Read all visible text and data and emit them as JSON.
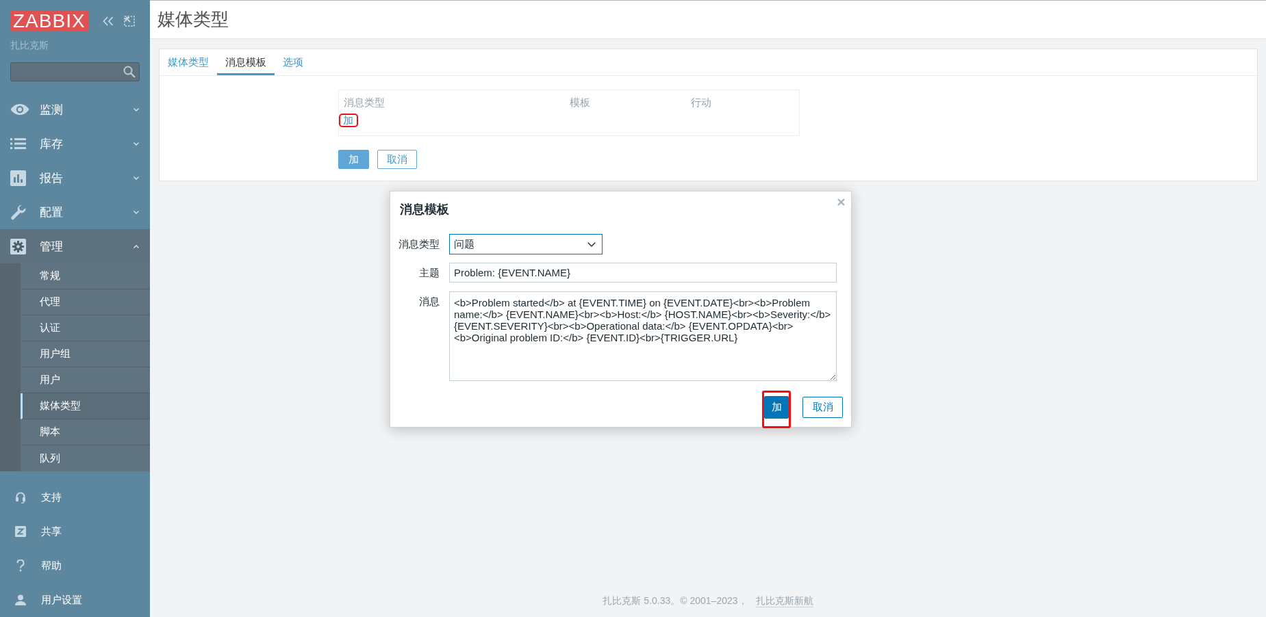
{
  "sidebar": {
    "logo": "ZABBIX",
    "server_name": "扎比克斯",
    "menu": [
      {
        "label": "监测",
        "expanded": false
      },
      {
        "label": "库存",
        "expanded": false
      },
      {
        "label": "报告",
        "expanded": false
      },
      {
        "label": "配置",
        "expanded": false
      },
      {
        "label": "管理",
        "expanded": true,
        "children": [
          {
            "label": "常规",
            "selected": false
          },
          {
            "label": "代理",
            "selected": false
          },
          {
            "label": "认证",
            "selected": false
          },
          {
            "label": "用户组",
            "selected": false
          },
          {
            "label": "用户",
            "selected": false
          },
          {
            "label": "媒体类型",
            "selected": true
          },
          {
            "label": "脚本",
            "selected": false
          },
          {
            "label": "队列",
            "selected": false
          }
        ]
      }
    ],
    "footer_links": [
      {
        "label": "支持"
      },
      {
        "label": "共享"
      },
      {
        "label": "帮助"
      },
      {
        "label": "用户设置"
      }
    ]
  },
  "header": {
    "title": "媒体类型"
  },
  "tabs": [
    {
      "label": "媒体类型",
      "selected": false
    },
    {
      "label": "消息模板",
      "selected": true
    },
    {
      "label": "选项",
      "selected": false
    }
  ],
  "template_table": {
    "columns": [
      "消息类型",
      "模板",
      "行动"
    ],
    "add_link": {
      "label": "加",
      "annotated": true
    }
  },
  "form_buttons": [
    {
      "label": "加",
      "kind": "primary"
    },
    {
      "label": "取消",
      "kind": "secondary"
    }
  ],
  "dialog": {
    "title": "消息模板",
    "fields": [
      {
        "label": "消息类型",
        "kind": "select",
        "value": "问题",
        "focused": true
      },
      {
        "label": "主题",
        "kind": "input",
        "value": "Problem: {EVENT.NAME}",
        "focused": false
      },
      {
        "label": "消息",
        "kind": "textarea",
        "value": "<b>Problem started</b> at {EVENT.TIME} on {EVENT.DATE}<br><b>Problem name:</b> {EVENT.NAME}<br><b>Host:</b> {HOST.NAME}<br><b>Severity:</b> {EVENT.SEVERITY}<br><b>Operational data:</b> {EVENT.OPDATA}<br><b>Original problem ID:</b> {EVENT.ID}<br>{TRIGGER.URL}",
        "focused": false
      }
    ],
    "buttons": [
      {
        "label": "加",
        "kind": "primary",
        "annotated": true
      },
      {
        "label": "取消",
        "kind": "secondary",
        "annotated": false
      }
    ]
  },
  "footer": {
    "text": "扎比克斯 5.0.33。© 2001–2023，",
    "link": "扎比克斯新航"
  }
}
